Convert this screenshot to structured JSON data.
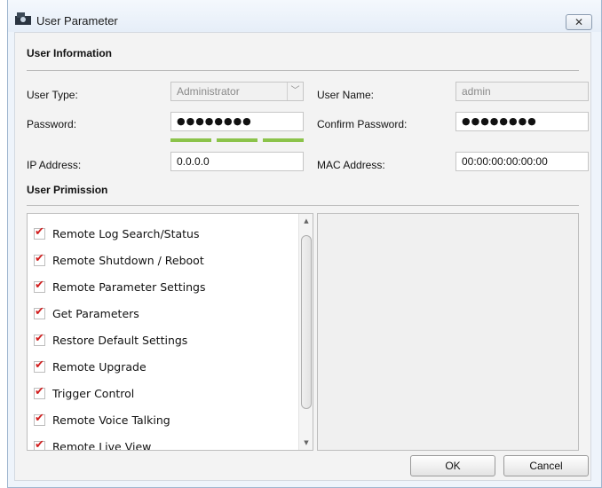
{
  "window": {
    "title": "User Parameter",
    "close_glyph": "✕",
    "icon": "user-parameter-app-icon"
  },
  "user_information": {
    "section_title": "User Information",
    "user_type": {
      "label": "User Type:",
      "value": "Administrator"
    },
    "user_name": {
      "label": "User Name:",
      "value": "admin"
    },
    "password": {
      "label": "Password:",
      "value": "●●●●●●●●"
    },
    "confirm_password": {
      "label": "Confirm Password:",
      "value": "●●●●●●●●"
    },
    "password_strength": {
      "level": 3,
      "max": 3,
      "color": "#8bc34a"
    },
    "ip_address": {
      "label": "IP Address:",
      "value": "0.0.0.0"
    },
    "mac_address": {
      "label": "MAC Address:",
      "value": "00:00:00:00:00:00"
    }
  },
  "user_permission": {
    "section_title": "User Primission",
    "items": [
      {
        "label": "Remote Log Search/Status",
        "checked": true
      },
      {
        "label": "Remote Shutdown / Reboot",
        "checked": true
      },
      {
        "label": "Remote Parameter Settings",
        "checked": true
      },
      {
        "label": "Get Parameters",
        "checked": true
      },
      {
        "label": "Restore Default Settings",
        "checked": true
      },
      {
        "label": "Remote Upgrade",
        "checked": true
      },
      {
        "label": "Trigger Control",
        "checked": true
      },
      {
        "label": "Remote Voice Talking",
        "checked": true
      },
      {
        "label": "Remote Live View",
        "checked": true
      }
    ],
    "check_glyph": "✔",
    "check_color": "#d11f1f"
  },
  "buttons": {
    "ok_label": "OK",
    "cancel_label": "Cancel"
  }
}
